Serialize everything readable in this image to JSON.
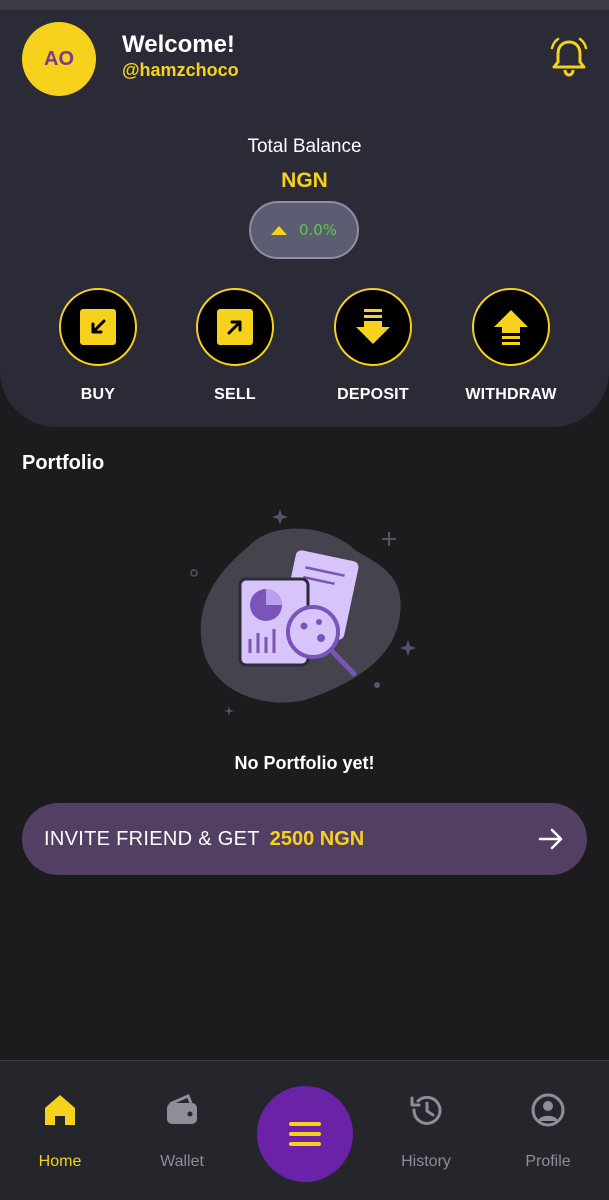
{
  "header": {
    "avatar_initials": "AO",
    "welcome": "Welcome!",
    "username": "@hamzchoco",
    "bell_icon": "bell-icon"
  },
  "balance": {
    "label": "Total Balance",
    "currency": "NGN",
    "change": "0.0%"
  },
  "actions": [
    {
      "label": "BUY",
      "icon": "arrow-down-left-icon"
    },
    {
      "label": "SELL",
      "icon": "arrow-up-right-icon"
    },
    {
      "label": "DEPOSIT",
      "icon": "deposit-icon"
    },
    {
      "label": "WITHDRAW",
      "icon": "withdraw-icon"
    }
  ],
  "portfolio": {
    "title": "Portfolio",
    "empty_message": "No Portfolio yet!"
  },
  "invite": {
    "text": "INVITE FRIEND & GET",
    "amount": "2500 NGN"
  },
  "nav": [
    {
      "label": "Home",
      "icon": "home-icon",
      "active": true
    },
    {
      "label": "Wallet",
      "icon": "wallet-icon",
      "active": false
    },
    {
      "label": "",
      "icon": "menu-icon",
      "active": false
    },
    {
      "label": "History",
      "icon": "history-icon",
      "active": false
    },
    {
      "label": "Profile",
      "icon": "profile-icon",
      "active": false
    }
  ],
  "colors": {
    "accent": "#f7d21c",
    "header_bg": "#2b2b38",
    "page_bg": "#1c1c1f",
    "invite_bg": "#533e64",
    "fab": "#6a22a6",
    "positive": "#5cc84a"
  }
}
